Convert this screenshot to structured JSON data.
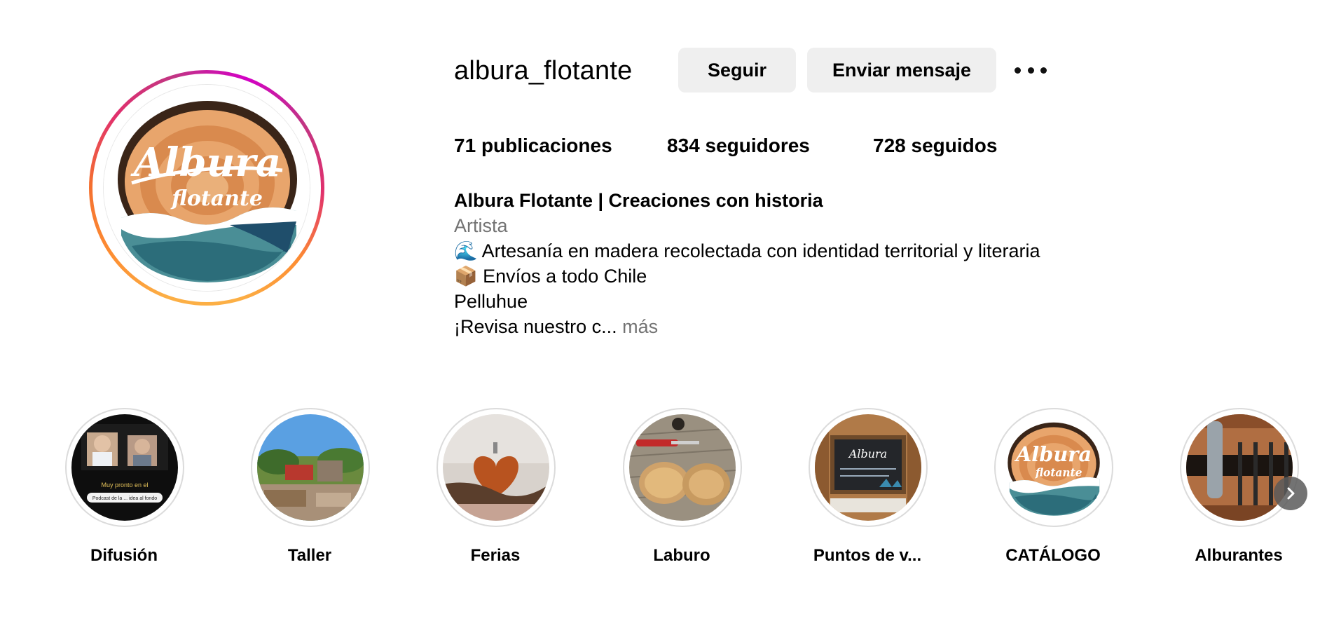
{
  "profile": {
    "username": "albura_flotante",
    "avatar_logo_line1": "Albura",
    "avatar_logo_line2": "flotante"
  },
  "actions": {
    "follow_label": "Seguir",
    "message_label": "Enviar mensaje",
    "more_icon": "more-horizontal-icon"
  },
  "stats": {
    "posts_count": "71",
    "posts_label": "publicaciones",
    "followers_count": "834",
    "followers_label": "seguidores",
    "following_count": "728",
    "following_label": "seguidos"
  },
  "bio": {
    "name": "Albura Flotante | Creaciones con historia",
    "category": "Artista",
    "line1": "🌊 Artesanía en madera recolectada con identidad territorial y literaria",
    "line2": "📦 Envíos a todo Chile",
    "line3": "Pelluhue",
    "line4": "¡Revisa nuestro c...",
    "more_label": "más"
  },
  "highlights": [
    {
      "label": "Difusión"
    },
    {
      "label": "Taller"
    },
    {
      "label": "Ferias"
    },
    {
      "label": "Laburo"
    },
    {
      "label": "Puntos de v..."
    },
    {
      "label": "CATÁLOGO"
    },
    {
      "label": "Alburantes"
    }
  ],
  "highlight_thumbs": {
    "difusion_banner": "Muy pronto en el",
    "difusion_chip": "Podcast de la ... idea al fondo"
  },
  "colors": {
    "button_bg": "#efefef",
    "muted_text": "#737373",
    "ring_gradient_start": "#fcaf45",
    "ring_gradient_end": "#d300c5"
  }
}
